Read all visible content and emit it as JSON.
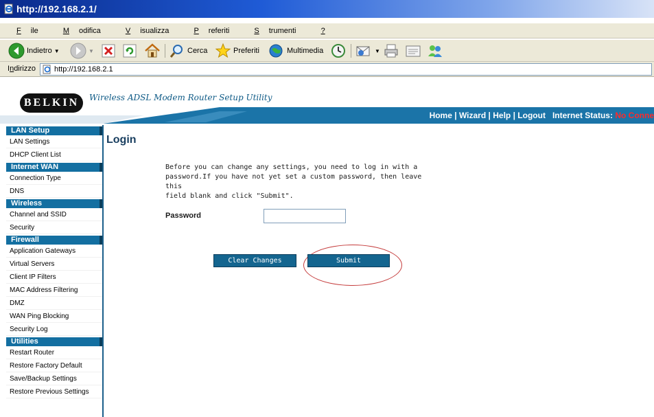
{
  "window": {
    "title": "http://192.168.2.1/"
  },
  "menu": [
    "File",
    "Modifica",
    "Visualizza",
    "Preferiti",
    "Strumenti",
    "?"
  ],
  "toolbar": {
    "back_label": "Indietro",
    "search_label": "Cerca",
    "favorites_label": "Preferiti",
    "media_label": "Multimedia"
  },
  "address": {
    "label": "Indirizzo",
    "url": "http://192.168.2.1"
  },
  "banner": {
    "brand": "BELKIN",
    "tagline": "Wireless ADSL Modem Router Setup Utility"
  },
  "nav": {
    "home": "Home",
    "wizard": "Wizard",
    "help": "Help",
    "logout": "Logout",
    "status_label": "Internet Status:",
    "status_value": "No Conne"
  },
  "sidebar": {
    "sections": [
      {
        "title": "LAN Setup",
        "items": [
          "LAN Settings",
          "DHCP Client List"
        ]
      },
      {
        "title": "Internet WAN",
        "items": [
          "Connection Type",
          "DNS"
        ]
      },
      {
        "title": "Wireless",
        "items": [
          "Channel and SSID",
          "Security"
        ]
      },
      {
        "title": "Firewall",
        "items": [
          "Application Gateways",
          "Virtual Servers",
          "Client IP Filters",
          "MAC Address Filtering",
          "DMZ",
          "WAN Ping Blocking",
          "Security Log"
        ]
      },
      {
        "title": "Utilities",
        "items": [
          "Restart Router",
          "Restore Factory Default",
          "Save/Backup Settings",
          "Restore Previous Settings"
        ]
      }
    ]
  },
  "login": {
    "title": "Login",
    "intro_lines": [
      "Before you can change any settings, you need to log in with a",
      "password.If you have not yet set a custom password, then leave this",
      "field blank and click \"Submit\"."
    ],
    "password_label": "Password",
    "password_value": "",
    "clear_label": "Clear Changes",
    "submit_label": "Submit"
  },
  "colors": {
    "banner_blue": "#1b74a8",
    "sidebar_header": "#136fa1",
    "button": "#14658f",
    "status_red": "#ff2a2a",
    "annotation_circle": "#c43a3a"
  }
}
